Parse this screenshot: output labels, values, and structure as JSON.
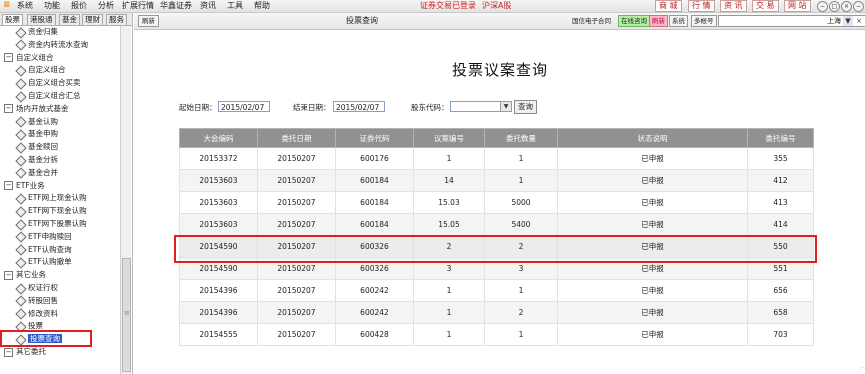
{
  "menubar": {
    "logo_glyph": "≡",
    "items": [
      "系统",
      "功能",
      "报价",
      "分析",
      "扩展行情",
      "华鑫证券",
      "资讯",
      "工具",
      "帮助"
    ],
    "status_left": "证券交易已登录",
    "status_right": "沪深A股",
    "quick_buttons": [
      "商 城",
      "行 情",
      "资 讯",
      "交 易",
      "网 站"
    ],
    "window_controls": [
      "−",
      "□",
      "×",
      "−"
    ]
  },
  "left_panel": {
    "tabs": [
      "股票",
      "港股通",
      "基金",
      "理财",
      "服务"
    ],
    "active_tab": 0,
    "tree": [
      {
        "label": "资金归集",
        "kind": "leaf",
        "indent": 2
      },
      {
        "label": "资金内转流水查询",
        "kind": "leaf",
        "indent": 2
      },
      {
        "label": "自定义组合",
        "kind": "group",
        "indent": 0
      },
      {
        "label": "自定义组合",
        "kind": "leaf",
        "indent": 2
      },
      {
        "label": "自定义组合买卖",
        "kind": "leaf",
        "indent": 2
      },
      {
        "label": "自定义组合汇总",
        "kind": "leaf",
        "indent": 2
      },
      {
        "label": "场内开放式基金",
        "kind": "group",
        "indent": 0
      },
      {
        "label": "基金认购",
        "kind": "leaf",
        "indent": 2
      },
      {
        "label": "基金申购",
        "kind": "leaf",
        "indent": 2
      },
      {
        "label": "基金赎回",
        "kind": "leaf",
        "indent": 2
      },
      {
        "label": "基金分拆",
        "kind": "leaf",
        "indent": 2
      },
      {
        "label": "基金合并",
        "kind": "leaf",
        "indent": 2
      },
      {
        "label": "ETF业务",
        "kind": "group",
        "indent": 0
      },
      {
        "label": "ETF网上现金认购",
        "kind": "leaf",
        "indent": 2
      },
      {
        "label": "ETF网下现金认购",
        "kind": "leaf",
        "indent": 2
      },
      {
        "label": "ETF网下股票认购",
        "kind": "leaf",
        "indent": 2
      },
      {
        "label": "ETF申购赎回",
        "kind": "leaf",
        "indent": 2
      },
      {
        "label": "ETF认购查询",
        "kind": "leaf",
        "indent": 2
      },
      {
        "label": "ETF认购撤单",
        "kind": "leaf",
        "indent": 2
      },
      {
        "label": "其它业务",
        "kind": "group",
        "indent": 0
      },
      {
        "label": "权证行权",
        "kind": "leaf",
        "indent": 2
      },
      {
        "label": "转股回售",
        "kind": "leaf",
        "indent": 2
      },
      {
        "label": "修改资料",
        "kind": "leaf",
        "indent": 2
      },
      {
        "label": "投票",
        "kind": "leaf",
        "indent": 2
      },
      {
        "label": "投票查询",
        "kind": "leaf",
        "indent": 2,
        "selected": true
      },
      {
        "label": "其它委托",
        "kind": "group",
        "indent": 0
      }
    ]
  },
  "right_bar": {
    "refresh_label": "刷新",
    "title": "投票查询",
    "company_label": "国信电子合同",
    "buttons": [
      "在线咨询",
      "刷新",
      "系统",
      "多帐号"
    ],
    "account_value": "上海",
    "account_dropdown_glyph": "▼",
    "account_close_glyph": "×"
  },
  "content": {
    "heading": "投票议案查询",
    "start_label": "起始日期：",
    "start_value": "2015/02/07",
    "end_label": "结束日期：",
    "end_value": "2015/02/07",
    "holder_label": "股东代码：",
    "dropdown_glyph": "▼",
    "query_label": "查询"
  },
  "table": {
    "columns": [
      "大会编码",
      "委托日期",
      "证券代码",
      "议案编号",
      "委托数量",
      "状态说明",
      "委托编号"
    ],
    "rows": [
      [
        "20153372",
        "20150207",
        "600176",
        "1",
        "1",
        "已申报",
        "355"
      ],
      [
        "20153603",
        "20150207",
        "600184",
        "14",
        "1",
        "已申报",
        "412"
      ],
      [
        "20153603",
        "20150207",
        "600184",
        "15.03",
        "5000",
        "已申报",
        "413"
      ],
      [
        "20153603",
        "20150207",
        "600184",
        "15.05",
        "5400",
        "已申报",
        "414"
      ],
      [
        "20154590",
        "20150207",
        "600326",
        "2",
        "2",
        "已申报",
        "550"
      ],
      [
        "20154590",
        "20150207",
        "600326",
        "3",
        "3",
        "已申报",
        "551"
      ],
      [
        "20154396",
        "20150207",
        "600242",
        "1",
        "1",
        "已申报",
        "656"
      ],
      [
        "20154396",
        "20150207",
        "600242",
        "1",
        "2",
        "已申报",
        "658"
      ],
      [
        "20154555",
        "20150207",
        "600428",
        "1",
        "1",
        "已申报",
        "703"
      ]
    ],
    "highlighted_row": 4
  },
  "colors": {
    "accent_red": "#e02020",
    "header_gray": "#919191",
    "selected_blue": "#2d5dcc",
    "online_green": "#b6f0a4"
  }
}
